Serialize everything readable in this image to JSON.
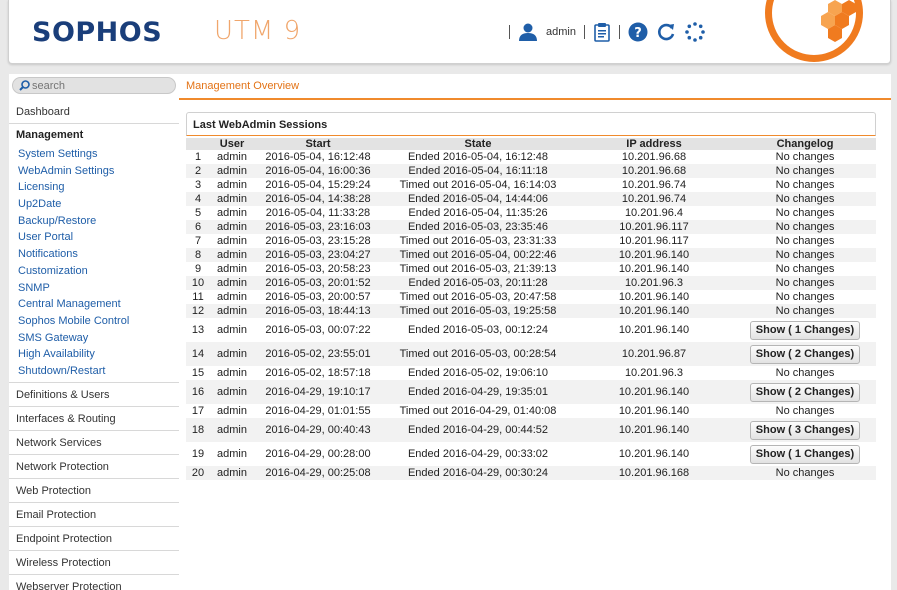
{
  "header": {
    "brand": "SOPHOS",
    "product": "UTM 9",
    "user": "admin",
    "icons": [
      "user-icon",
      "notes-icon",
      "help-icon",
      "refresh-icon",
      "busy-spinner-icon"
    ]
  },
  "search": {
    "placeholder": "search"
  },
  "sidebar": {
    "dashboard": "Dashboard",
    "management": "Management",
    "management_items": [
      "System Settings",
      "WebAdmin Settings",
      "Licensing",
      "Up2Date",
      "Backup/Restore",
      "User Portal",
      "Notifications",
      "Customization",
      "SNMP",
      "Central Management",
      "Sophos Mobile Control",
      "SMS Gateway",
      "High Availability",
      "Shutdown/Restart"
    ],
    "sections": [
      "Definitions & Users",
      "Interfaces & Routing",
      "Network Services",
      "Network Protection",
      "Web Protection",
      "Email Protection",
      "Endpoint Protection",
      "Wireless Protection",
      "Webserver Protection"
    ]
  },
  "breadcrumb": "Management Overview",
  "panel": {
    "title": "Last WebAdmin Sessions",
    "columns": [
      "",
      "User",
      "Start",
      "State",
      "IP address",
      "Changelog"
    ],
    "rows": [
      {
        "n": "1",
        "user": "admin",
        "start": "2016-05-04, 16:12:48",
        "state": "Ended 2016-05-04, 16:12:48",
        "ip": "10.201.96.68",
        "log": "No changes"
      },
      {
        "n": "2",
        "user": "admin",
        "start": "2016-05-04, 16:00:36",
        "state": "Ended 2016-05-04, 16:11:18",
        "ip": "10.201.96.68",
        "log": "No changes"
      },
      {
        "n": "3",
        "user": "admin",
        "start": "2016-05-04, 15:29:24",
        "state": "Timed out 2016-05-04, 16:14:03",
        "ip": "10.201.96.74",
        "log": "No changes"
      },
      {
        "n": "4",
        "user": "admin",
        "start": "2016-05-04, 14:38:28",
        "state": "Ended 2016-05-04, 14:44:06",
        "ip": "10.201.96.74",
        "log": "No changes"
      },
      {
        "n": "5",
        "user": "admin",
        "start": "2016-05-04, 11:33:28",
        "state": "Ended 2016-05-04, 11:35:26",
        "ip": "10.201.96.4",
        "log": "No changes"
      },
      {
        "n": "6",
        "user": "admin",
        "start": "2016-05-03, 23:16:03",
        "state": "Ended 2016-05-03, 23:35:46",
        "ip": "10.201.96.117",
        "log": "No changes"
      },
      {
        "n": "7",
        "user": "admin",
        "start": "2016-05-03, 23:15:28",
        "state": "Timed out 2016-05-03, 23:31:33",
        "ip": "10.201.96.117",
        "log": "No changes"
      },
      {
        "n": "8",
        "user": "admin",
        "start": "2016-05-03, 23:04:27",
        "state": "Timed out 2016-05-04, 00:22:46",
        "ip": "10.201.96.140",
        "log": "No changes"
      },
      {
        "n": "9",
        "user": "admin",
        "start": "2016-05-03, 20:58:23",
        "state": "Timed out 2016-05-03, 21:39:13",
        "ip": "10.201.96.140",
        "log": "No changes"
      },
      {
        "n": "10",
        "user": "admin",
        "start": "2016-05-03, 20:01:52",
        "state": "Ended 2016-05-03, 20:11:28",
        "ip": "10.201.96.3",
        "log": "No changes"
      },
      {
        "n": "11",
        "user": "admin",
        "start": "2016-05-03, 20:00:57",
        "state": "Timed out 2016-05-03, 20:47:58",
        "ip": "10.201.96.140",
        "log": "No changes"
      },
      {
        "n": "12",
        "user": "admin",
        "start": "2016-05-03, 18:44:13",
        "state": "Timed out 2016-05-03, 19:25:58",
        "ip": "10.201.96.140",
        "log": "No changes"
      },
      {
        "n": "13",
        "user": "admin",
        "start": "2016-05-03, 00:07:22",
        "state": "Ended 2016-05-03, 00:12:24",
        "ip": "10.201.96.140",
        "log": "Show ( 1 Changes)"
      },
      {
        "n": "14",
        "user": "admin",
        "start": "2016-05-02, 23:55:01",
        "state": "Timed out 2016-05-03, 00:28:54",
        "ip": "10.201.96.87",
        "log": "Show ( 2 Changes)"
      },
      {
        "n": "15",
        "user": "admin",
        "start": "2016-05-02, 18:57:18",
        "state": "Ended 2016-05-02, 19:06:10",
        "ip": "10.201.96.3",
        "log": "No changes"
      },
      {
        "n": "16",
        "user": "admin",
        "start": "2016-04-29, 19:10:17",
        "state": "Ended 2016-04-29, 19:35:01",
        "ip": "10.201.96.140",
        "log": "Show ( 2 Changes)"
      },
      {
        "n": "17",
        "user": "admin",
        "start": "2016-04-29, 01:01:55",
        "state": "Timed out 2016-04-29, 01:40:08",
        "ip": "10.201.96.140",
        "log": "No changes"
      },
      {
        "n": "18",
        "user": "admin",
        "start": "2016-04-29, 00:40:43",
        "state": "Ended 2016-04-29, 00:44:52",
        "ip": "10.201.96.140",
        "log": "Show ( 3 Changes)"
      },
      {
        "n": "19",
        "user": "admin",
        "start": "2016-04-29, 00:28:00",
        "state": "Ended 2016-04-29, 00:33:02",
        "ip": "10.201.96.140",
        "log": "Show ( 1 Changes)"
      },
      {
        "n": "20",
        "user": "admin",
        "start": "2016-04-29, 00:25:08",
        "state": "Ended 2016-04-29, 00:30:24",
        "ip": "10.201.96.168",
        "log": "No changes"
      }
    ]
  },
  "colors": {
    "brand_blue": "#1a3e7a",
    "accent_orange": "#f07b1f",
    "link_blue": "#1f5ea8"
  }
}
